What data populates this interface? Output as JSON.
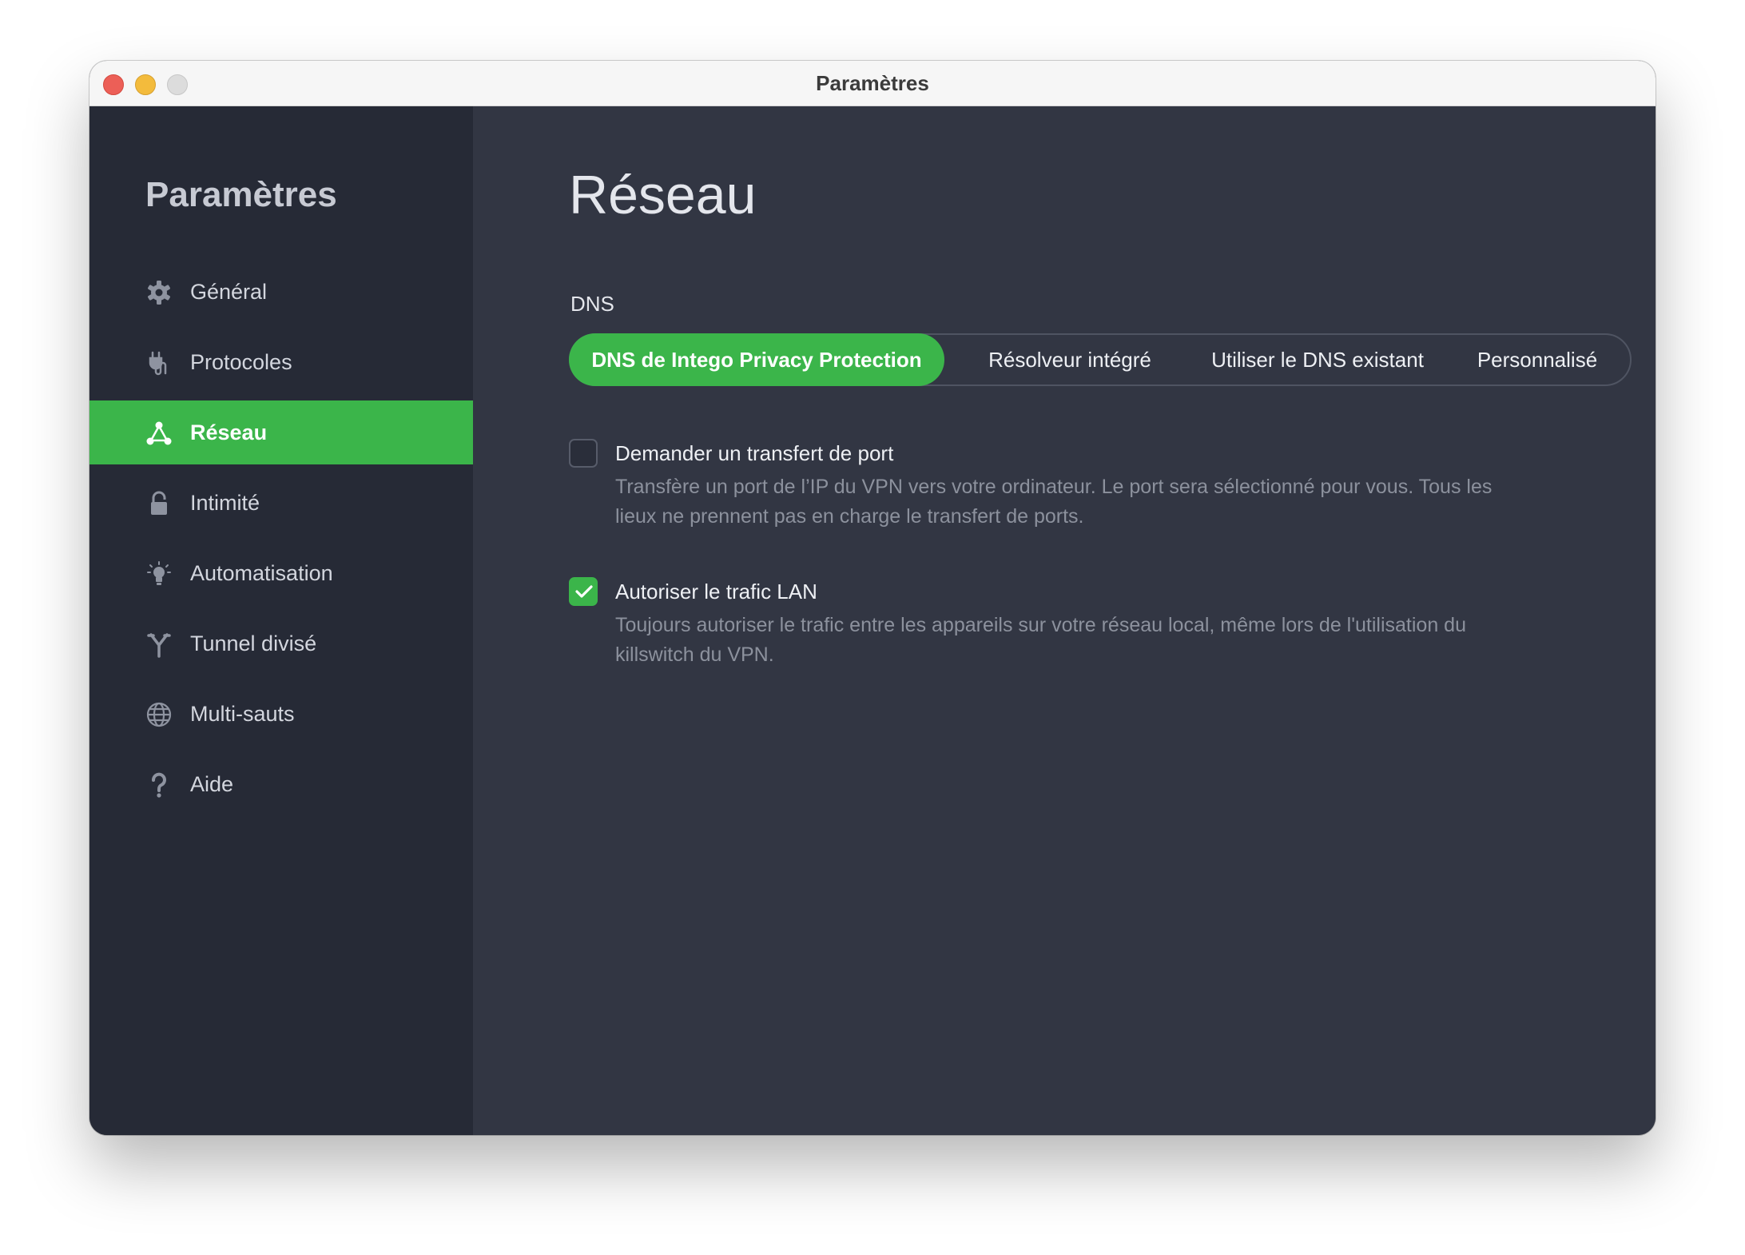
{
  "window": {
    "title": "Paramètres"
  },
  "sidebar": {
    "title": "Paramètres",
    "items": [
      {
        "label": "Général",
        "icon": "gear-icon",
        "active": false
      },
      {
        "label": "Protocoles",
        "icon": "plug-icon",
        "active": false
      },
      {
        "label": "Réseau",
        "icon": "network-icon",
        "active": true
      },
      {
        "label": "Intimité",
        "icon": "lock-icon",
        "active": false
      },
      {
        "label": "Automatisation",
        "icon": "lightbulb-icon",
        "active": false
      },
      {
        "label": "Tunnel divisé",
        "icon": "split-tunnel-icon",
        "active": false
      },
      {
        "label": "Multi-sauts",
        "icon": "globe-icon",
        "active": false
      },
      {
        "label": "Aide",
        "icon": "question-icon",
        "active": false
      }
    ]
  },
  "main": {
    "title": "Réseau",
    "dns": {
      "label": "DNS",
      "options": [
        "DNS de Intego Privacy Protection",
        "Résolveur intégré",
        "Utiliser le DNS existant",
        "Personnalisé"
      ],
      "selected": "DNS de Intego Privacy Protection"
    },
    "port_forwarding": {
      "label": "Demander un transfert de port",
      "checked": false,
      "description_line1": "Transfère un port de l’IP du VPN vers votre ordinateur. Le port sera sélectionné pour vous. Tous les",
      "description_line2": "lieux ne prennent pas en charge le transfert de ports."
    },
    "lan_traffic": {
      "label": "Autoriser le trafic LAN",
      "checked": true,
      "description_line1": "Toujours autoriser le trafic entre les appareils sur votre réseau local, même lors de l'utilisation du",
      "description_line2": "killswitch du VPN."
    }
  },
  "colors": {
    "accent": "#3bb54a",
    "sidebar_bg": "#262a36",
    "main_bg": "#323643"
  }
}
